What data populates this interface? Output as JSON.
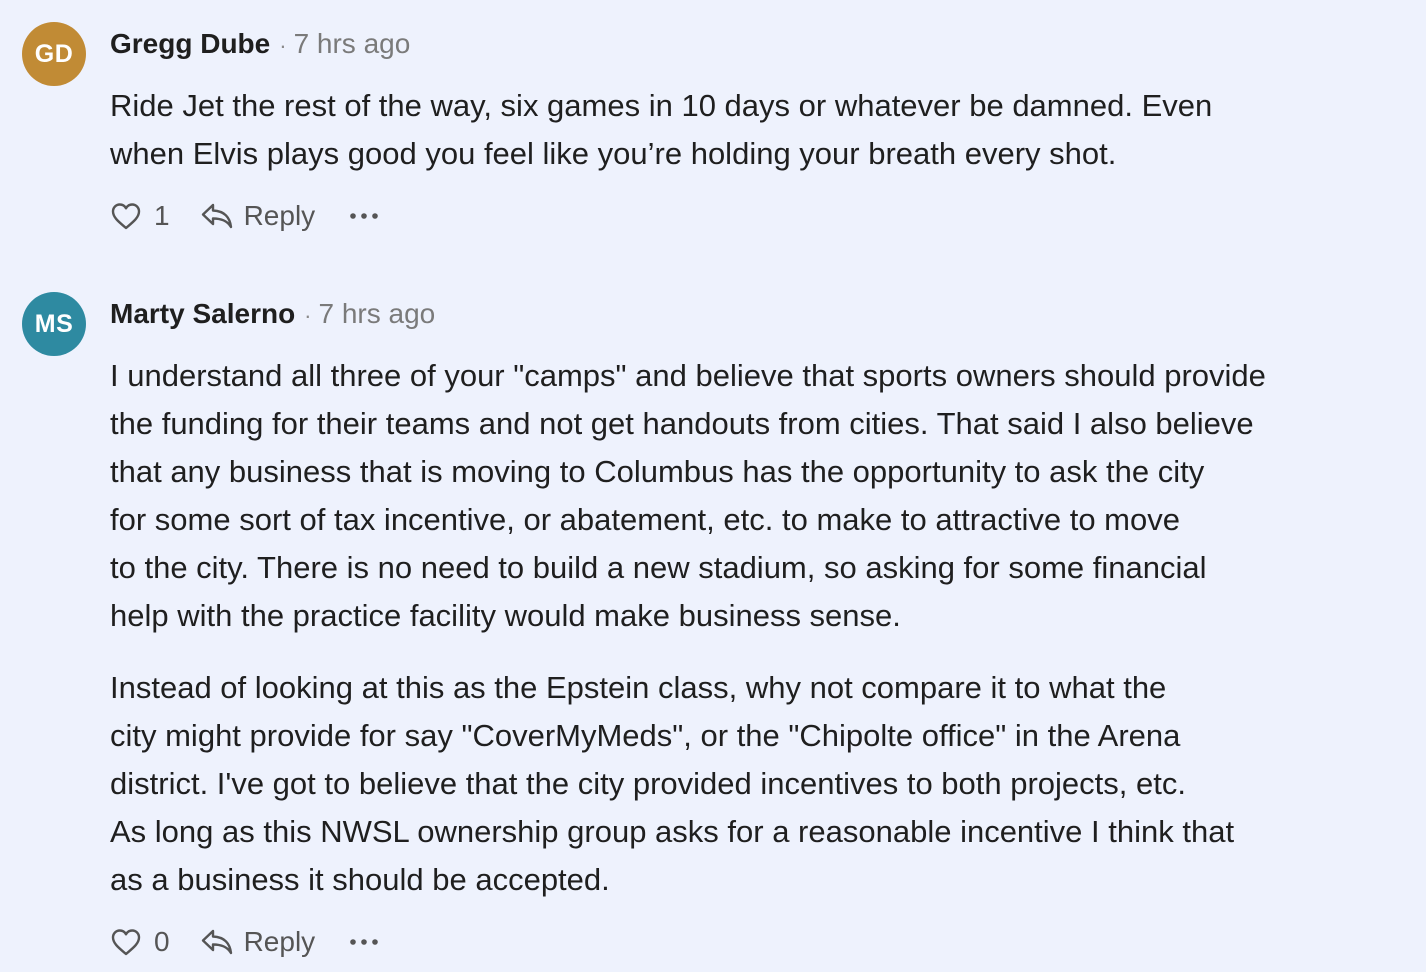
{
  "comments": [
    {
      "initials": "GD",
      "avatar_color": "#c18b35",
      "author": "Gregg Dube",
      "separator": "·",
      "time": "7 hrs ago",
      "paragraphs": [
        "Ride Jet the rest of the way, six games in 10 days or whatever be damned. Even\nwhen Elvis plays good you feel like you’re holding your breath every shot."
      ],
      "likes": "1",
      "reply_label": "Reply",
      "like_icon": "heart-icon",
      "reply_icon": "reply-arrow-icon",
      "more_icon": "ellipsis-icon"
    },
    {
      "initials": "MS",
      "avatar_color": "#2e8aa1",
      "author": "Marty Salerno",
      "separator": "·",
      "time": "7 hrs ago",
      "paragraphs": [
        "I understand all three of your \"camps\" and believe that sports owners should provide\nthe funding for their teams and not get handouts from cities. That said I also believe\nthat any business that is moving to Columbus has the opportunity to ask the city\nfor some sort of tax incentive, or abatement, etc. to make to attractive to move\nto the city. There is no need to build a new stadium, so asking for some financial\nhelp with the practice facility would make business sense.",
        "Instead of looking at this as the Epstein class, why not compare it to what the\ncity might provide for say \"CoverMyMeds\", or the \"Chipolte office\" in the Arena\ndistrict. I've got to believe that the city provided incentives to both projects, etc.\nAs long as this NWSL ownership group asks for a reasonable incentive I think that\nas a business it should be accepted."
      ],
      "likes": "0",
      "reply_label": "Reply",
      "like_icon": "heart-icon",
      "reply_icon": "reply-arrow-icon",
      "more_icon": "ellipsis-icon"
    }
  ]
}
